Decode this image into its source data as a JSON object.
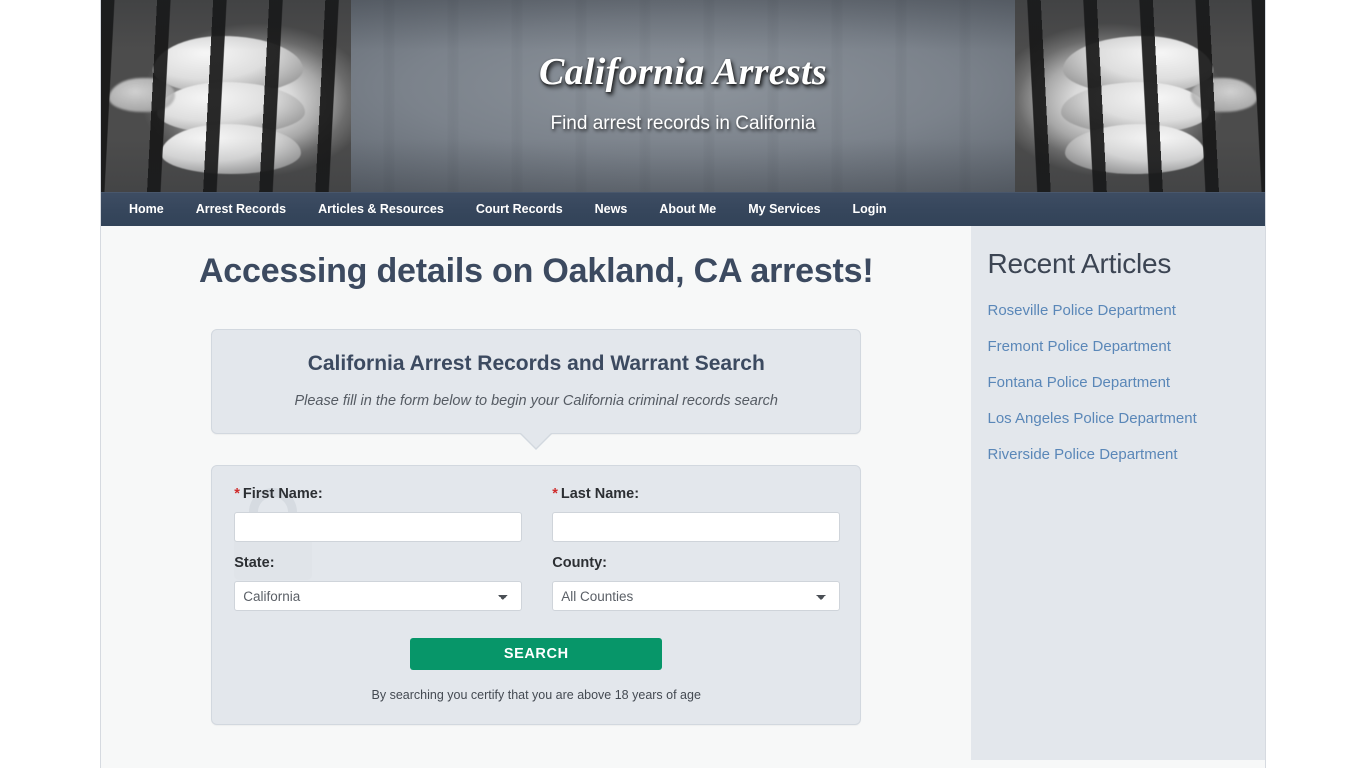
{
  "site": {
    "title": "California Arrests",
    "tagline": "Find arrest records in California"
  },
  "nav": {
    "items": [
      {
        "label": "Home",
        "name": "nav-item-home"
      },
      {
        "label": "Arrest Records",
        "name": "nav-item-arrest-records"
      },
      {
        "label": "Articles & Resources",
        "name": "nav-item-articles-resources"
      },
      {
        "label": "Court Records",
        "name": "nav-item-court-records"
      },
      {
        "label": "News",
        "name": "nav-item-news"
      },
      {
        "label": "About Me",
        "name": "nav-item-about-me"
      },
      {
        "label": "My Services",
        "name": "nav-item-my-services"
      },
      {
        "label": "Login",
        "name": "nav-item-login"
      }
    ]
  },
  "main": {
    "page_title": "Accessing details on Oakland, CA arrests!",
    "callout": {
      "title": "California Arrest Records and Warrant Search",
      "subtitle": "Please fill in the form below to begin your California criminal records search"
    },
    "form": {
      "first_name": {
        "label": "First Name:",
        "required_marker": "*",
        "value": "",
        "placeholder": ""
      },
      "last_name": {
        "label": "Last Name:",
        "required_marker": "*",
        "value": "",
        "placeholder": ""
      },
      "state": {
        "label": "State:",
        "selected": "California",
        "options": [
          "California"
        ]
      },
      "county": {
        "label": "County:",
        "selected": "All Counties",
        "options": [
          "All Counties"
        ]
      },
      "submit_label": "SEARCH",
      "disclaimer": "By searching you certify that you are above 18 years of age"
    }
  },
  "sidebar": {
    "title": "Recent Articles",
    "links": [
      "Roseville Police Department",
      "Fremont Police Department",
      "Fontana Police Department",
      "Los Angeles Police Department",
      "Riverside Police Department"
    ]
  },
  "colors": {
    "nav_bar": "#36465c",
    "heading_navy": "#3c4a60",
    "search_green": "#079669",
    "link_blue": "#5a87b8",
    "required_red": "#cf2b2b",
    "panel_gray": "#e3e7ec",
    "page_gray": "#f7f8f8"
  }
}
